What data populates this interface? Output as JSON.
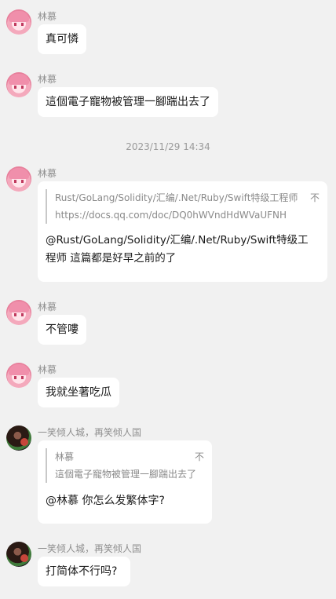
{
  "timestamp": "2023/11/29 14:34",
  "messages": [
    {
      "sender": "林慕",
      "text": "真可憐"
    },
    {
      "sender": "林慕",
      "text": "這個電子寵物被管理一腳踹出去了"
    },
    {
      "sender": "林慕",
      "quote_line1": "Rust/GoLang/Solidity/汇编/.Net/Ruby/Swift特级工程师",
      "quote_tail": "不",
      "quote_line2": "https://docs.qq.com/doc/DQ0hWVndHdWVaUFNH",
      "text_line1": "@Rust/GoLang/Solidity/汇编/.Net/Ruby/Swift特级工",
      "text_line2": "程师 這篇都是好早之前的了"
    },
    {
      "sender": "林慕",
      "text": "不管嘍"
    },
    {
      "sender": "林慕",
      "text": "我就坐著吃瓜"
    },
    {
      "sender": "一笑倾人城，再笑倾人国",
      "quote_sender": "林慕",
      "quote_tail": "不",
      "quote_text": "這個電子寵物被管理一腳踹出去了",
      "text": "@林慕 你怎么发繁体字?"
    },
    {
      "sender": "一笑倾人城，再笑倾人国",
      "text": "打简体不行吗?"
    }
  ]
}
